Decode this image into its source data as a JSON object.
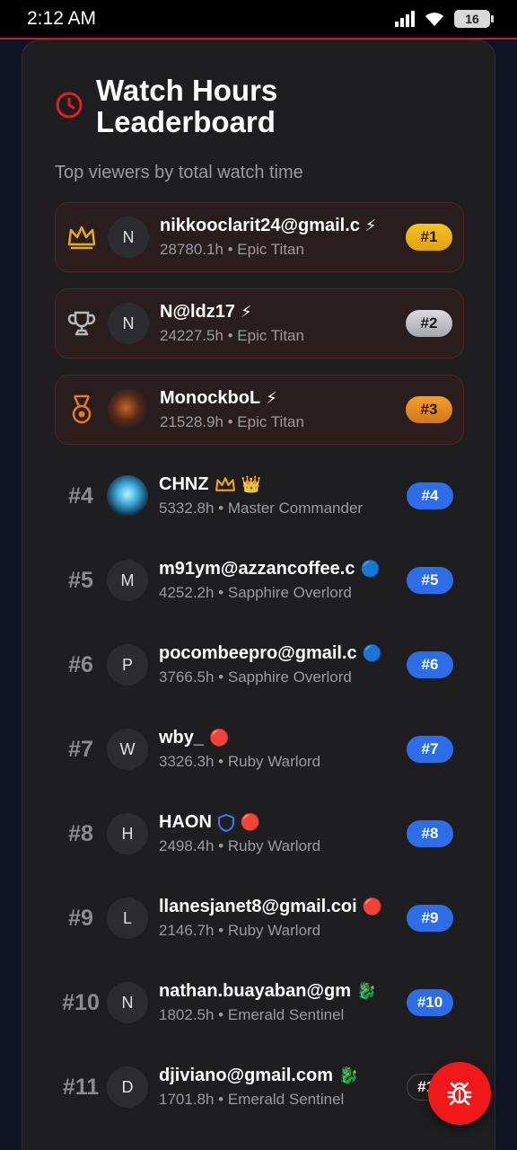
{
  "status_bar": {
    "time": "2:12 AM",
    "battery": "16"
  },
  "header": {
    "title": "Watch Hours Leaderboard",
    "subtitle": "Top viewers by total watch time"
  },
  "leaderboard": [
    {
      "rank_label": "",
      "icon": "crown-icon",
      "avatar": "N",
      "name": "nikkooclarit24@gmail.c",
      "badge": "⚡",
      "hours": "28780.1h • Epic Titan",
      "pill": "#1",
      "pill_style": "gold"
    },
    {
      "rank_label": "",
      "icon": "trophy-icon",
      "avatar": "N",
      "name": "N@ldz17",
      "badge": "⚡",
      "hours": "24227.5h • Epic Titan",
      "pill": "#2",
      "pill_style": "silver"
    },
    {
      "rank_label": "",
      "icon": "medal-icon",
      "avatar": "",
      "name": "MonockboL",
      "badge": "⚡",
      "hours": "21528.9h • Epic Titan",
      "pill": "#3",
      "pill_style": "bronze"
    },
    {
      "rank_label": "#4",
      "icon": "",
      "avatar": "",
      "name": "CHNZ",
      "badge": "👑",
      "hours": "5332.8h • Master Commander",
      "pill": "#4",
      "pill_style": "blue"
    },
    {
      "rank_label": "#5",
      "icon": "",
      "avatar": "M",
      "name": "m91ym@azzancoffee.c",
      "badge": "🔵",
      "hours": "4252.2h • Sapphire Overlord",
      "pill": "#5",
      "pill_style": "blue"
    },
    {
      "rank_label": "#6",
      "icon": "",
      "avatar": "P",
      "name": "pocombeepro@gmail.c",
      "badge": "🔵",
      "hours": "3766.5h • Sapphire Overlord",
      "pill": "#6",
      "pill_style": "blue"
    },
    {
      "rank_label": "#7",
      "icon": "",
      "avatar": "W",
      "name": "wby_",
      "badge": "🔴",
      "hours": "3326.3h • Ruby Warlord",
      "pill": "#7",
      "pill_style": "blue"
    },
    {
      "rank_label": "#8",
      "icon": "",
      "avatar": "H",
      "name": "HAON",
      "badge": "🔴",
      "hours": "2498.4h • Ruby Warlord",
      "pill": "#8",
      "pill_style": "blue"
    },
    {
      "rank_label": "#9",
      "icon": "",
      "avatar": "L",
      "name": "llanesjanet8@gmail.coi",
      "badge": "🔴",
      "hours": "2146.7h • Ruby Warlord",
      "pill": "#9",
      "pill_style": "blue"
    },
    {
      "rank_label": "#10",
      "icon": "",
      "avatar": "N",
      "name": "nathan.buayaban@gm",
      "badge": "🐉",
      "hours": "1802.5h • Emerald Sentinel",
      "pill": "#10",
      "pill_style": "blue"
    },
    {
      "rank_label": "#11",
      "icon": "",
      "avatar": "D",
      "name": "djiviano@gmail.com",
      "badge": "🐉",
      "hours": "1701.8h • Emerald Sentinel",
      "pill": "#11",
      "pill_style": "outline"
    }
  ]
}
